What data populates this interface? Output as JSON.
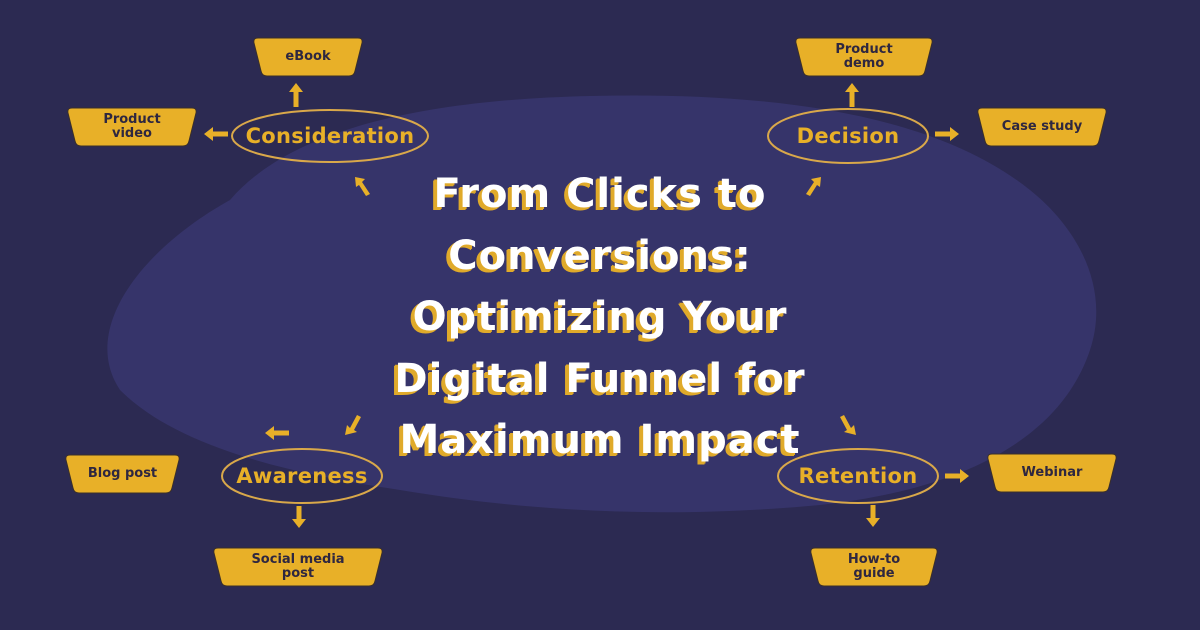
{
  "colors": {
    "background": "#2c2a52",
    "blob": "#36346a",
    "accent": "#e8b028",
    "card_text": "#2e2740",
    "title_text": "#ffffff",
    "title_shadow": "#e0aa2a"
  },
  "title": {
    "lines": [
      "From Clicks to",
      "Conversions:",
      "Optimizing Your",
      "Digital Funnel for",
      "Maximum Impact"
    ]
  },
  "stages": {
    "consideration": {
      "label": "Consideration",
      "items": {
        "up": "eBook",
        "left": "Product video"
      }
    },
    "decision": {
      "label": "Decision",
      "items": {
        "up": "Product demo",
        "right": "Case study"
      }
    },
    "awareness": {
      "label": "Awareness",
      "items": {
        "left": "Blog post",
        "down": "Social media post"
      }
    },
    "retention": {
      "label": "Retention",
      "items": {
        "right": "Webinar",
        "down": "How-to guide"
      }
    }
  },
  "icons": {
    "arrow_up": "arrow-up-icon",
    "arrow_left": "arrow-left-icon",
    "arrow_right": "arrow-right-icon",
    "arrow_down": "arrow-down-icon",
    "arrow_diagonal": "arrow-diagonal-icon"
  }
}
